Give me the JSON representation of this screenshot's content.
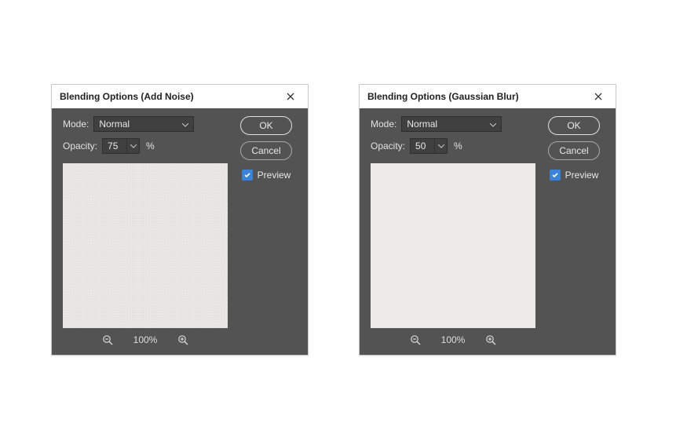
{
  "dialogs": [
    {
      "title": "Blending Options (Add Noise)",
      "mode_label": "Mode:",
      "mode_value": "Normal",
      "opacity_label": "Opacity:",
      "opacity_value": "75",
      "opacity_unit": "%",
      "ok_label": "OK",
      "cancel_label": "Cancel",
      "preview_label": "Preview",
      "preview_checked": true,
      "zoom_level": "100%"
    },
    {
      "title": "Blending Options (Gaussian Blur)",
      "mode_label": "Mode:",
      "mode_value": "Normal",
      "opacity_label": "Opacity:",
      "opacity_value": "50",
      "opacity_unit": "%",
      "ok_label": "OK",
      "cancel_label": "Cancel",
      "preview_label": "Preview",
      "preview_checked": true,
      "zoom_level": "100%"
    }
  ]
}
